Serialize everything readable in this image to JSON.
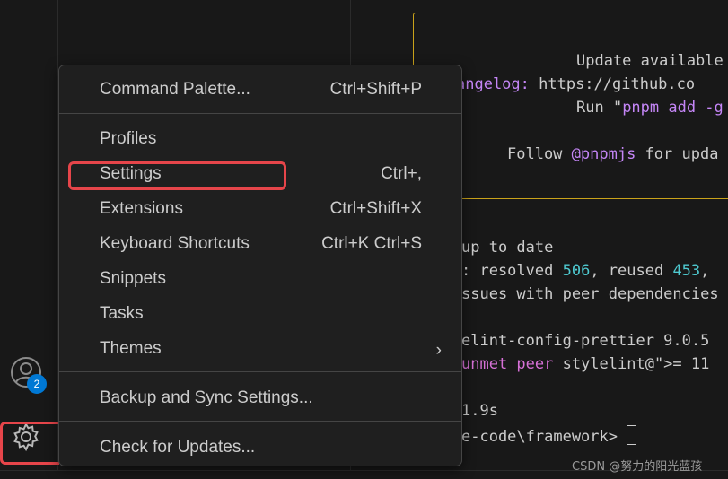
{
  "activity_bar": {
    "account_badge": "2"
  },
  "terminal": {
    "lines": [
      {
        "parts": [
          {
            "t": "Update available",
            "c": ""
          }
        ]
      },
      {
        "parts": [
          {
            "t": "angelog: ",
            "c": "purple"
          },
          {
            "t": "https://github.co",
            "c": ""
          }
        ]
      },
      {
        "parts": [
          {
            "t": "Run \"",
            "c": ""
          },
          {
            "t": "pnpm add -g",
            "c": "purple"
          }
        ]
      },
      {
        "parts": [
          {
            "t": "Follow ",
            "c": ""
          },
          {
            "t": "@pnpmjs",
            "c": "purple"
          },
          {
            "t": " for upda",
            "c": ""
          }
        ]
      },
      {
        "parts": [
          {
            "t": "up to date",
            "c": ""
          }
        ]
      },
      {
        "parts": [
          {
            "t": ": resolved ",
            "c": ""
          },
          {
            "t": "506",
            "c": "cyan"
          },
          {
            "t": ", reused ",
            "c": ""
          },
          {
            "t": "453",
            "c": "cyan"
          },
          {
            "t": ",",
            "c": ""
          }
        ]
      },
      {
        "parts": [
          {
            "t": "ssues with peer dependencies",
            "c": ""
          }
        ]
      },
      {
        "parts": [
          {
            "t": "elint-config-prettier 9.0.5",
            "c": ""
          }
        ]
      },
      {
        "parts": [
          {
            "t": "unmet peer",
            "c": "magenta"
          },
          {
            "t": " stylelint@\">= 11",
            "c": ""
          }
        ]
      },
      {
        "parts": [
          {
            "t": "1.9s",
            "c": ""
          }
        ]
      },
      {
        "parts": [
          {
            "t": "e-code\\framework> ",
            "c": ""
          }
        ]
      }
    ]
  },
  "menu": {
    "items": [
      {
        "label": "Command Palette...",
        "shortcut": "Ctrl+Shift+P"
      },
      {
        "label": "Profiles",
        "shortcut": ""
      },
      {
        "label": "Settings",
        "shortcut": "Ctrl+,"
      },
      {
        "label": "Extensions",
        "shortcut": "Ctrl+Shift+X"
      },
      {
        "label": "Keyboard Shortcuts",
        "shortcut": "Ctrl+K Ctrl+S"
      },
      {
        "label": "Snippets",
        "shortcut": ""
      },
      {
        "label": "Tasks",
        "shortcut": ""
      },
      {
        "label": "Themes",
        "shortcut": "",
        "submenu_arrow": "›"
      },
      {
        "label": "Backup and Sync Settings...",
        "shortcut": ""
      },
      {
        "label": "Check for Updates...",
        "shortcut": ""
      }
    ]
  },
  "watermark": "CSDN @努力的阳光蓝孩",
  "colors": {
    "accent_badge": "#0078d4",
    "highlight_box": "#e6454a",
    "update_border": "#c9a21a"
  },
  "icons": {
    "account": "account-icon",
    "manage": "gear-icon"
  }
}
